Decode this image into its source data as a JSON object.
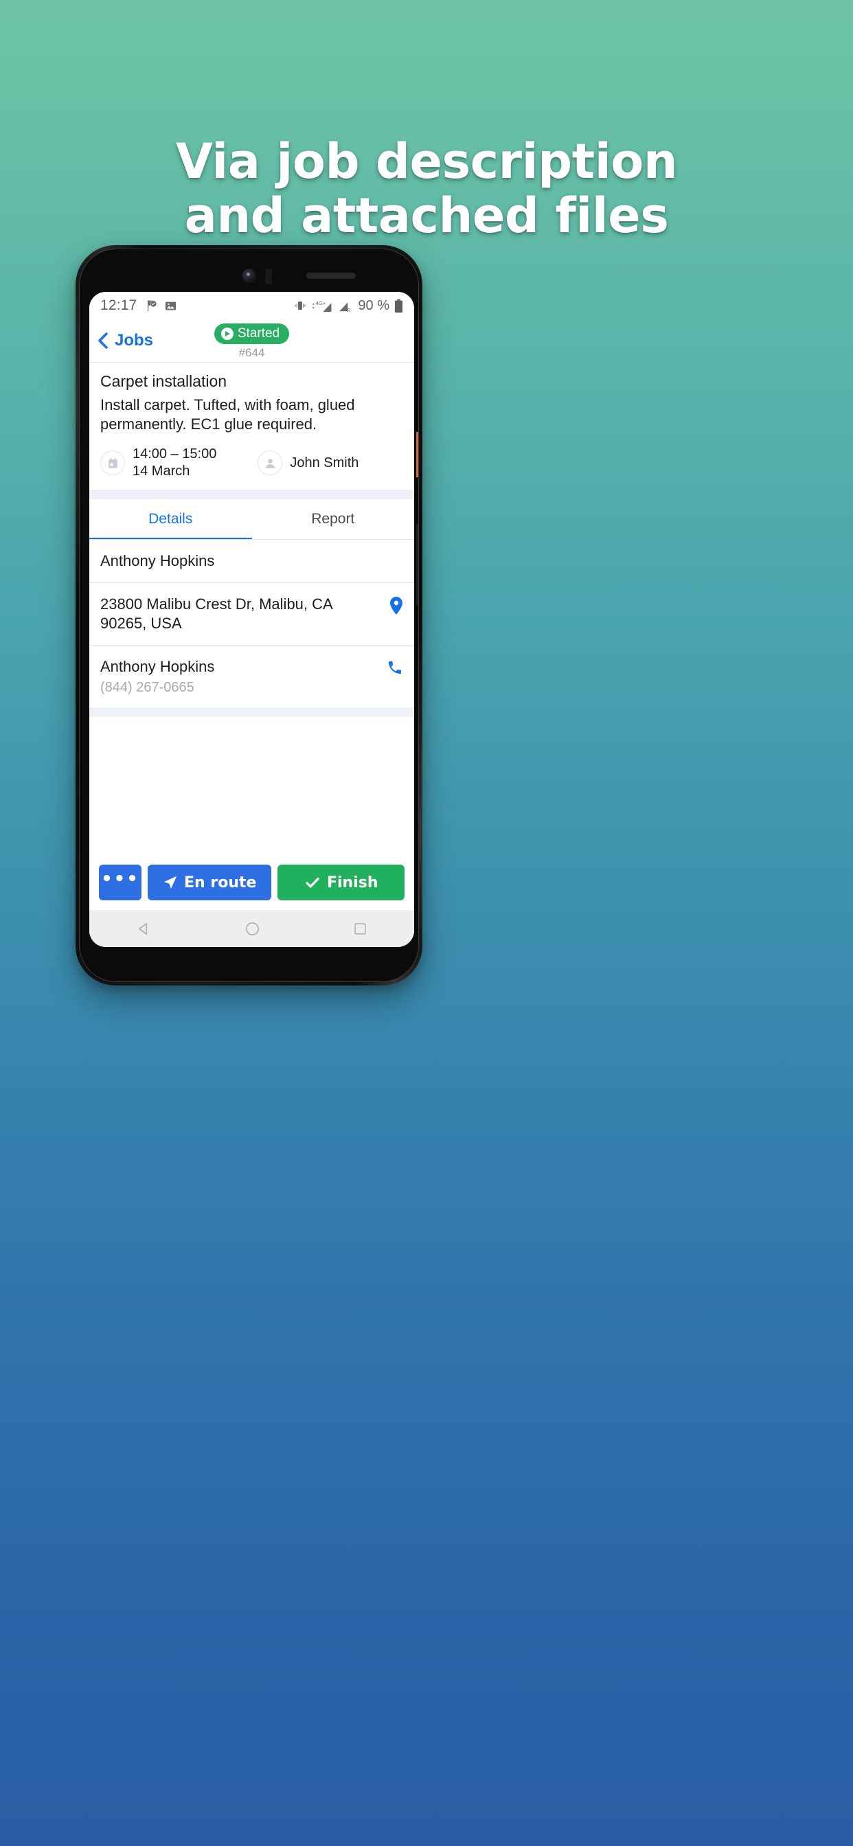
{
  "headline": {
    "line1": "Via job description",
    "line2": "and attached files"
  },
  "colors": {
    "accent_blue": "#1673e6",
    "button_blue": "#2f6fe4",
    "success_green": "#21b05d",
    "badge_green": "#27ae60",
    "muted_text": "#a8a8ae",
    "band_bg": "#eef1f5"
  },
  "statusbar": {
    "time": "12:17",
    "battery_percent": "90 %",
    "icons": [
      "task-check-icon",
      "image-icon",
      "vibrate-icon",
      "signal-4g-plus-icon",
      "signal-roaming-icon",
      "battery-icon"
    ],
    "network": "4G+",
    "roaming": "R"
  },
  "header": {
    "back_label": "Jobs",
    "status_badge": "Started",
    "job_number": "#644"
  },
  "job": {
    "title": "Carpet installation",
    "description": "Install carpet. Tufted, with foam, glued permanently. EC1 glue required.",
    "time_range": "14:00 – 15:00",
    "date": "14 March",
    "assignee": "John Smith"
  },
  "tabs": [
    {
      "label": "Details",
      "active": true
    },
    {
      "label": "Report",
      "active": false
    }
  ],
  "details": [
    {
      "primary": "Anthony Hopkins",
      "secondary": "",
      "icon": ""
    },
    {
      "primary": "23800 Malibu Crest Dr, Malibu, CA 90265, USA",
      "secondary": "",
      "icon": "location-pin-icon"
    },
    {
      "primary": "Anthony Hopkins",
      "secondary": "(844) 267-0665",
      "icon": "phone-icon"
    }
  ],
  "actions": {
    "more_label": "•••",
    "en_route_label": "En route",
    "finish_label": "Finish"
  },
  "navbar": {
    "back": "nav-back-icon",
    "home": "nav-home-icon",
    "recents": "nav-recents-icon"
  }
}
